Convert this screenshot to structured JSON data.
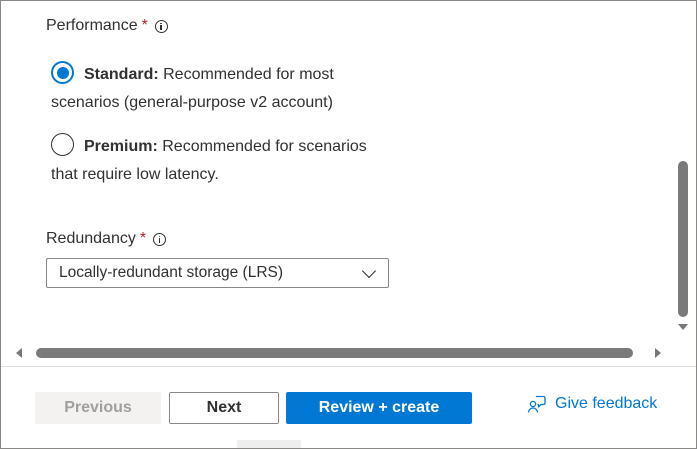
{
  "performance": {
    "label": "Performance",
    "required_marker": "*",
    "options": [
      {
        "name": "Standard:",
        "description": "Recommended for most scenarios (general-purpose v2 account)",
        "selected": true
      },
      {
        "name": "Premium:",
        "description": "Recommended for scenarios that require low latency.",
        "selected": false
      }
    ]
  },
  "redundancy": {
    "label": "Redundancy",
    "required_marker": "*",
    "selected_value": "Locally-redundant storage (LRS)"
  },
  "footer": {
    "previous_label": "Previous",
    "next_label": "Next",
    "review_label": "Review + create",
    "feedback_label": "Give feedback"
  },
  "colors": {
    "accent": "#0078d4",
    "required": "#a4262c",
    "disabled_bg": "#f3f2f1",
    "disabled_text": "#a19f9d"
  },
  "icons": [
    "info-icon",
    "chevron-down-icon",
    "feedback-icon"
  ]
}
